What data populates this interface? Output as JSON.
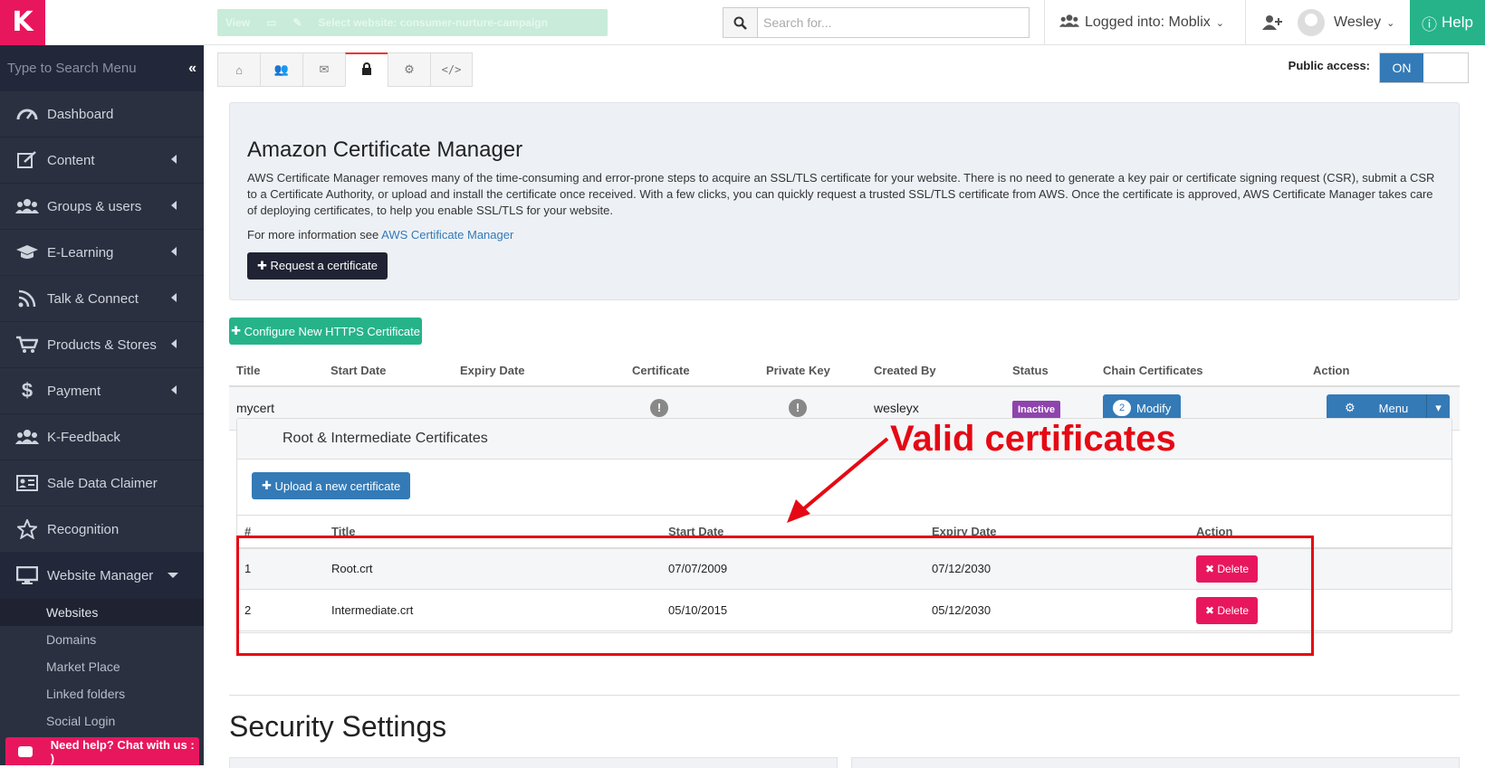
{
  "sidebar": {
    "logo": "K",
    "search_placeholder": "Type to Search Menu",
    "collapse": "«",
    "items": [
      {
        "label": "Dashboard"
      },
      {
        "label": "Content"
      },
      {
        "label": "Groups & users"
      },
      {
        "label": "E-Learning"
      },
      {
        "label": "Talk & Connect"
      },
      {
        "label": "Products & Stores"
      },
      {
        "label": "Payment"
      },
      {
        "label": "K-Feedback"
      },
      {
        "label": "Sale Data Claimer"
      },
      {
        "label": "Recognition"
      },
      {
        "label": "Website Manager"
      }
    ],
    "sub_items": [
      "Websites",
      "Domains",
      "Market Place",
      "Linked folders",
      "Social Login"
    ],
    "chat": "Need help? Chat with us : )"
  },
  "topbar": {
    "view_label": "View",
    "select_website": "Select website: consumer-nurture-campaign",
    "search_placeholder": "Search for...",
    "logged_into": "Logged into: Moblix",
    "user": "Wesley",
    "help": "Help"
  },
  "public_access": {
    "label": "Public access:",
    "on": "ON"
  },
  "acm": {
    "title": "Amazon Certificate Manager",
    "description": "AWS Certificate Manager removes many of the time-consuming and error-prone steps to acquire an SSL/TLS certificate for your website. There is no need to generate a key pair or certificate signing request (CSR), submit a CSR to a Certificate Authority, or upload and install the certificate once received. With a few clicks, you can quickly request a trusted SSL/TLS certificate from AWS. Once the certificate is approved, AWS Certificate Manager takes care of deploying certificates, to help you enable SSL/TLS for your website.",
    "more_prefix": "For more information see ",
    "more_link": "AWS Certificate Manager",
    "request_btn": "Request a certificate"
  },
  "configure_btn": "Configure New HTTPS Certificate",
  "certs_table": {
    "headers": [
      "Title",
      "Start Date",
      "Expiry Date",
      "Certificate",
      "Private Key",
      "Created By",
      "Status",
      "Chain Certificates",
      "Action"
    ],
    "row": {
      "title": "mycert",
      "start": "",
      "expiry": "",
      "created_by": "wesleyx",
      "status": "Inactive",
      "chain_count": "2",
      "modify": "Modify",
      "menu": "Menu"
    }
  },
  "chain": {
    "title": "Root & Intermediate Certificates",
    "upload_btn": "Upload a new certificate",
    "headers": [
      "#",
      "Title",
      "Start Date",
      "Expiry Date",
      "Action"
    ],
    "rows": [
      {
        "n": "1",
        "title": "Root.crt",
        "start": "07/07/2009",
        "expiry": "07/12/2030",
        "action": "Delete"
      },
      {
        "n": "2",
        "title": "Intermediate.crt",
        "start": "05/10/2015",
        "expiry": "05/12/2030",
        "action": "Delete"
      }
    ]
  },
  "annotation": "Valid certificates",
  "security_title": "Security Settings",
  "colors": {
    "brand": "#e8175d",
    "help": "#26b38a",
    "primary": "#337ab7",
    "annotation": "#e50914"
  }
}
